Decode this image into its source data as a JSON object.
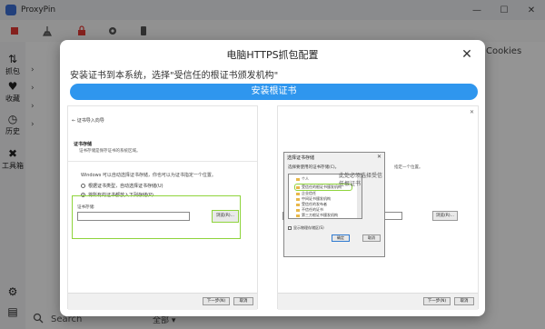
{
  "app": {
    "title": "ProxyPin",
    "window_controls": {
      "minimize": "—",
      "maximize": "☐",
      "close": "✕"
    }
  },
  "sidebar": {
    "items": [
      {
        "label": "抓包",
        "icon": "capture-icon"
      },
      {
        "label": "收藏",
        "icon": "heart-icon"
      },
      {
        "label": "历史",
        "icon": "history-icon"
      },
      {
        "label": "工具箱",
        "icon": "tools-icon"
      }
    ]
  },
  "list": {
    "rows": [
      {
        "prefix": "›"
      },
      {
        "prefix": "›"
      },
      {
        "prefix": "›"
      },
      {
        "prefix": "›"
      }
    ]
  },
  "right_panel": {
    "label": "Cookies"
  },
  "bottom": {
    "search_placeholder": "Search",
    "filter_label": "全部 ▾"
  },
  "dialog": {
    "title": "电脑HTTPS抓包配置",
    "description": "安装证书到本系统，选择\"受信任的根证书颁发机构\"",
    "install_button": "安装根证书",
    "close": "✕"
  },
  "wizard": {
    "header": "← 证书导入向导",
    "store_title": "证书存储",
    "store_sub": "证书存储是保存证书的系统区域。",
    "line1": "Windows 可以自动选择证书存储，你也可以为证书指定一个位置。",
    "radio_auto": "根据证书类型，自动选择证书存储(U)",
    "radio_manual": "将所有的证书都放入下列存储(P)",
    "field_label": "证书存储:",
    "browse": "浏览(R)...",
    "next": "下一步(N)",
    "cancel": "取消"
  },
  "right_shot": {
    "partial_text": "指定一个位置。",
    "browse": "浏览(R)...",
    "next": "下一步(N)",
    "cancel": "取消"
  },
  "store_dialog": {
    "title": "选择证书存储",
    "subtitle": "选择要使用的证书存储(C)。",
    "note": "此处必须选择受信任根证书",
    "tree": [
      "个人",
      "受信任的根证书颁发机构",
      "企业信任",
      "中间证书颁发机构",
      "受信任的发布者",
      "不信任的证书",
      "第三方根证书颁发机构"
    ],
    "show_physical": "显示物理存储区(S)",
    "ok": "确定",
    "cancel": "取消"
  },
  "colors": {
    "accent": "#2f96ee",
    "highlight": "#8fd43c",
    "close_red": "#e53935"
  }
}
